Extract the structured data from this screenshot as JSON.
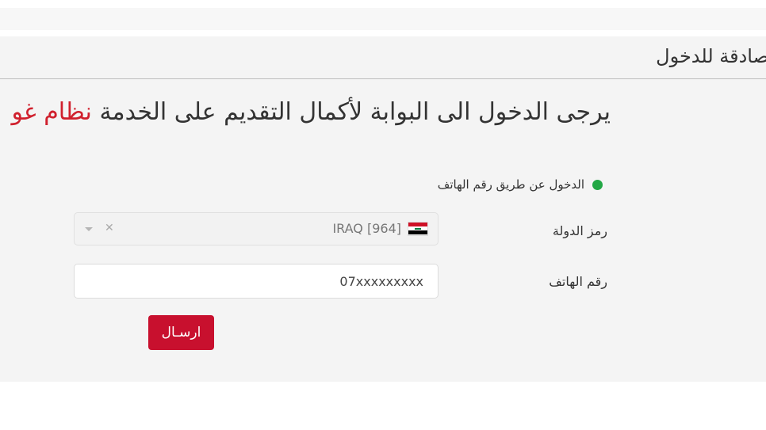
{
  "panel": {
    "title": "صادقة للدخول"
  },
  "headline": {
    "text": "يرجى الدخول الى البوابة لأكمال التقديم على الخدمة",
    "accent": "نظام غو"
  },
  "login_method": {
    "label": "الدخول عن طريق رقم الهاتف",
    "status_color": "#22a745"
  },
  "form": {
    "country_label": "رمز الدولة",
    "country_value": "IRAQ [964]",
    "country_flag": "iraq-flag-icon",
    "phone_label": "رقم الهاتف",
    "phone_placeholder": "07xxxxxxxxx"
  },
  "actions": {
    "send_label": "ارسـال",
    "accent_color": "#c8102e"
  }
}
